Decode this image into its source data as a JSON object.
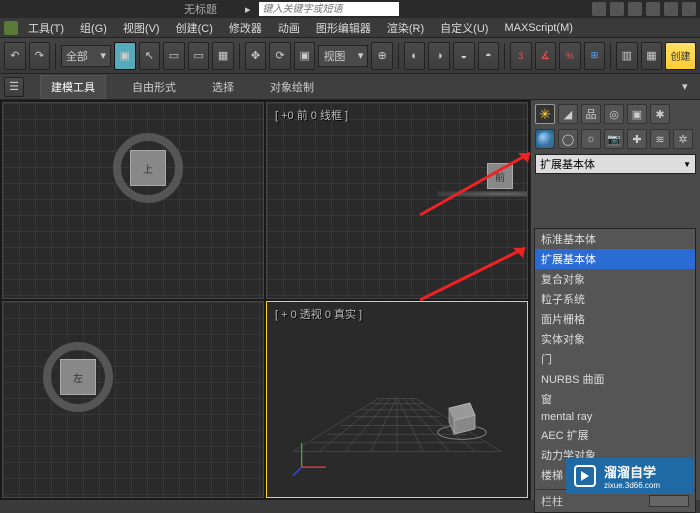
{
  "title": "无标题",
  "search_placeholder": "键入关键字或短语",
  "menu": [
    "工具(T)",
    "组(G)",
    "视图(V)",
    "创建(C)",
    "修改器",
    "动画",
    "图形编辑器",
    "渲染(R)",
    "自定义(U)",
    "MAXScript(M)"
  ],
  "toolbar": {
    "group_dd": "全部",
    "view_dd": "视图"
  },
  "ribbon": {
    "tabs": [
      "建模工具",
      "自由形式",
      "选择",
      "对象绘制"
    ]
  },
  "viewports": {
    "top_label": "上",
    "front_label": "[ +0 前 0 线框 ]",
    "front_cube": "前",
    "left_label": "左",
    "persp_label": "[ + 0 透视 0 真实 ]"
  },
  "create_panel": {
    "category": "扩展基本体"
  },
  "dropdown_items": [
    "标准基本体",
    "扩展基本体",
    "复合对象",
    "粒子系统",
    "面片栅格",
    "实体对象",
    "门",
    "NURBS 曲面",
    "窗",
    "mental ray",
    "AEC 扩展",
    "动力学对象",
    "楼梯"
  ],
  "dropdown_footer": "栏柱",
  "watermark": {
    "brand": "溜溜自学",
    "url": "zixue.3d66.com"
  },
  "create_btn": "创建"
}
